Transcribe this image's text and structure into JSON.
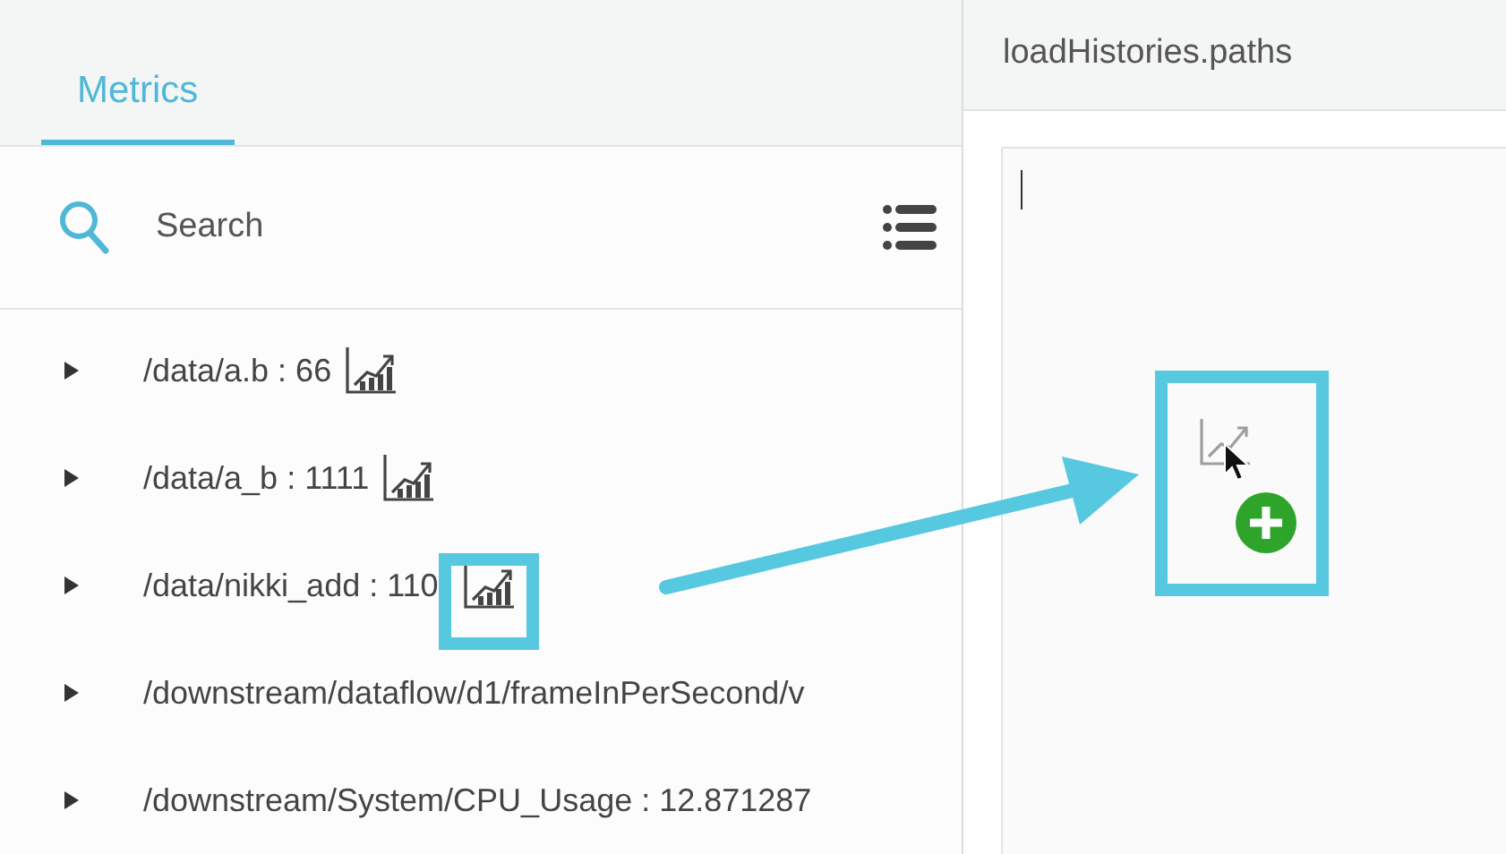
{
  "tabs": [
    {
      "label": "Metrics",
      "selected": true
    }
  ],
  "search": {
    "placeholder": "Search"
  },
  "metrics": [
    {
      "label": "/data/a.b : 66",
      "chart_icon": true,
      "expanded": false,
      "highlighted": false
    },
    {
      "label": "/data/a_b : 1111",
      "chart_icon": true,
      "expanded": false,
      "highlighted": false
    },
    {
      "label": "/data/nikki_add : 110",
      "chart_icon": true,
      "expanded": false,
      "highlighted": true
    },
    {
      "label": "/downstream/dataflow/d1/frameInPerSecond/v",
      "chart_icon": false,
      "expanded": false,
      "highlighted": false
    },
    {
      "label": "/downstream/System/CPU_Usage : 12.871287",
      "chart_icon": false,
      "expanded": false,
      "highlighted": false
    }
  ],
  "editor": {
    "title": "loadHistories.paths"
  }
}
